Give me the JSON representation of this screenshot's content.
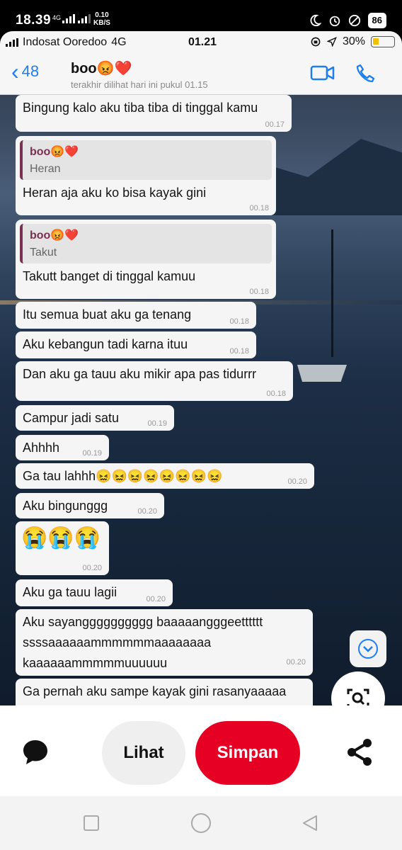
{
  "android_status": {
    "time": "18.39",
    "network": "4G",
    "speed_value": "0.10",
    "speed_unit": "KB/S",
    "battery": "86"
  },
  "ios_status": {
    "carrier": "Indosat Ooredoo",
    "network": "4G",
    "time": "01.21",
    "battery_pct": "30%",
    "battery_level": 0.3
  },
  "chat_header": {
    "back_count": "48",
    "contact_name": "boo😡❤️",
    "last_seen": "terakhir dilihat hari ini pukul 01.15"
  },
  "messages": [
    {
      "text": "Bingung kalo aku tiba tiba di tinggal kamu",
      "time": "00.17"
    },
    {
      "quote_name": "boo😡❤️",
      "quote_text": "Heran",
      "text": "Heran aja aku ko bisa kayak gini",
      "time": "00.18"
    },
    {
      "quote_name": "boo😡❤️",
      "quote_text": "Takut",
      "text": "Takutt banget di tinggal kamuu",
      "time": "00.18"
    },
    {
      "text": "Itu semua buat aku ga tenang",
      "time": "00.18"
    },
    {
      "text": "Aku kebangun tadi karna ituu",
      "time": "00.18"
    },
    {
      "text": "Dan aku ga tauu aku mikir apa pas tidurrr",
      "time": "00.18"
    },
    {
      "text": "Campur jadi satu",
      "time": "00.19"
    },
    {
      "text": "Ahhhh",
      "time": "00.19"
    },
    {
      "text": "Ga tau lahhh😖😖😖😖😖😖😖😖",
      "time": "00.20"
    },
    {
      "text": "Aku bingunggg",
      "time": "00.20"
    },
    {
      "text": "😭😭😭",
      "time": "00.20"
    },
    {
      "text": "Aku ga tauu lagii",
      "time": "00.20"
    },
    {
      "lines": [
        "Aku sayangggggggggg baaaaangggeetttttt",
        "ssssaaaaaammmmmmaaaaaaaa",
        "kaaaaaammmmmuuuuuu"
      ],
      "time": "00.20"
    },
    {
      "text": "Ga pernah aku sampe kayak gini rasanyaaaaa"
    }
  ],
  "actions": {
    "view_label": "Lihat",
    "save_label": "Simpan",
    "save_color": "#e60023"
  },
  "icons": {
    "comment": "comment-icon",
    "share": "share-icon",
    "lens": "visual-search-icon",
    "scroll": "chevron-down-icon"
  }
}
